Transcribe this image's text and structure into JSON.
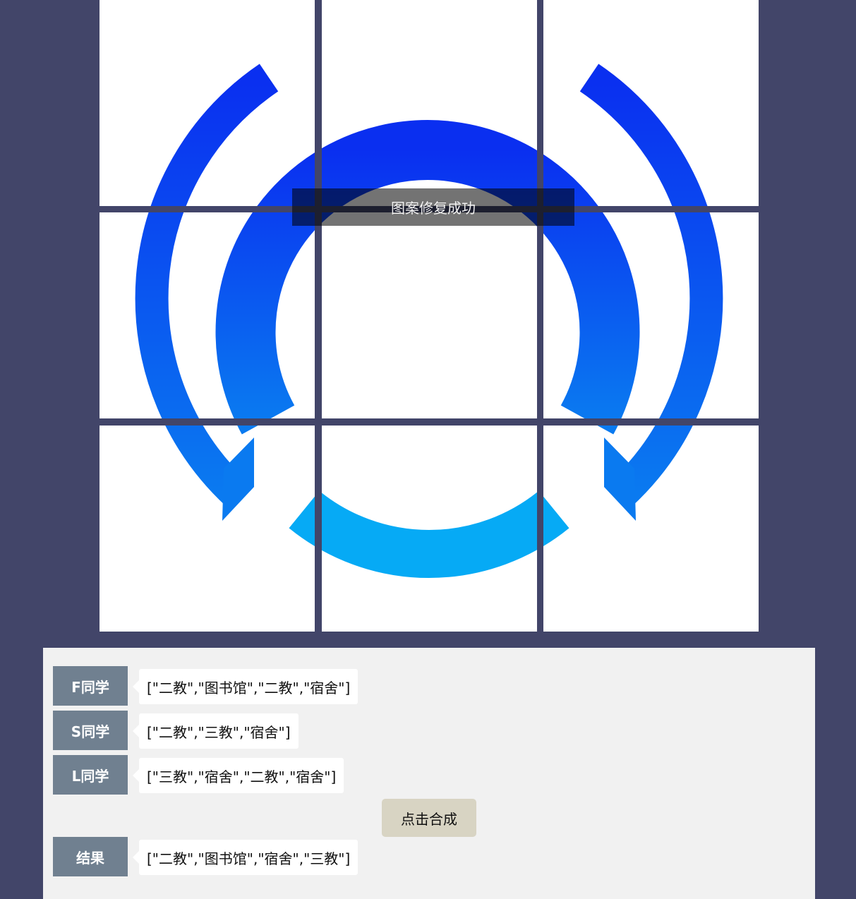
{
  "toast": {
    "message": "图案修复成功"
  },
  "students": [
    {
      "name": "F同学",
      "route": "[\"二教\",\"图书馆\",\"二教\",\"宿舍\"]"
    },
    {
      "name": "S同学",
      "route": "[\"二教\",\"三教\",\"宿舍\"]"
    },
    {
      "name": "L同学",
      "route": "[\"三教\",\"宿舍\",\"二教\",\"宿舍\"]"
    }
  ],
  "action": {
    "merge_label": "点击合成"
  },
  "result": {
    "name": "结果",
    "route": "[\"二教\",\"图书馆\",\"宿舍\",\"三教\"]"
  },
  "logo": {
    "color_top": "#0a2ff0",
    "color_bottom": "#0a7af0",
    "color_light": "#06aaf5"
  },
  "colors": {
    "background": "#424569",
    "tag": "#708090",
    "panel": "#f1f1f1",
    "button": "#d8d4c3"
  }
}
